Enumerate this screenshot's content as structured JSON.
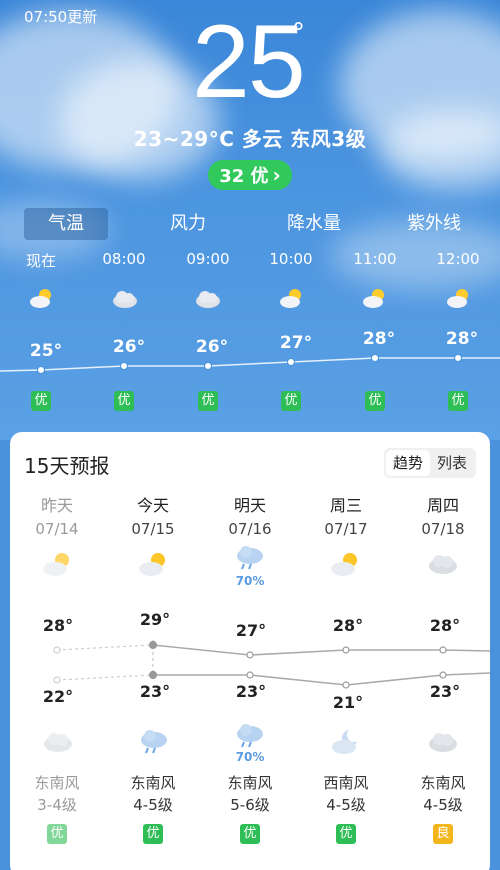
{
  "header": {
    "update_time": "07:50更新",
    "temperature": "25",
    "degree_symbol": "°",
    "summary": "23~29°C 多云 东风3级",
    "aqi_label": "32 优",
    "aqi_chevron": "›"
  },
  "tabs": [
    {
      "label": "气温",
      "active": true
    },
    {
      "label": "风力",
      "active": false
    },
    {
      "label": "降水量",
      "active": false
    },
    {
      "label": "紫外线",
      "active": false
    }
  ],
  "hourly": [
    {
      "time": "现在",
      "icon": "partly-cloudy-icon",
      "temp": "25°",
      "temp_value": 25,
      "aqi": "优"
    },
    {
      "time": "08:00",
      "icon": "cloudy-icon",
      "temp": "26°",
      "temp_value": 26,
      "aqi": "优"
    },
    {
      "time": "09:00",
      "icon": "cloudy-icon",
      "temp": "26°",
      "temp_value": 26,
      "aqi": "优"
    },
    {
      "time": "10:00",
      "icon": "partly-cloudy-icon",
      "temp": "27°",
      "temp_value": 27,
      "aqi": "优"
    },
    {
      "time": "11:00",
      "icon": "partly-cloudy-icon",
      "temp": "28°",
      "temp_value": 28,
      "aqi": "优"
    },
    {
      "time": "12:00",
      "icon": "partly-cloudy-icon",
      "temp": "28°",
      "temp_value": 28,
      "aqi": "优"
    }
  ],
  "forecast": {
    "title": "15天预报",
    "toggle": [
      "趋势",
      "列表"
    ],
    "days": [
      {
        "name": "昨天",
        "date": "07/14",
        "day_icon": "partly-cloudy-icon",
        "precip": "",
        "high": "28°",
        "high_value": 28,
        "low": "22°",
        "low_value": 22,
        "night_icon": "cloudy-icon",
        "night_precip": "",
        "wind_dir": "东南风",
        "wind_level": "3-4级",
        "aqi": "优",
        "past": true
      },
      {
        "name": "今天",
        "date": "07/15",
        "day_icon": "partly-cloudy-icon",
        "precip": "",
        "high": "29°",
        "high_value": 29,
        "low": "23°",
        "low_value": 23,
        "night_icon": "rain-cloud-icon",
        "night_precip": "",
        "wind_dir": "东南风",
        "wind_level": "4-5级",
        "aqi": "优",
        "past": false
      },
      {
        "name": "明天",
        "date": "07/16",
        "day_icon": "rain-cloud-icon",
        "precip": "70%",
        "high": "27°",
        "high_value": 27,
        "low": "23°",
        "low_value": 23,
        "night_icon": "rain-cloud-icon",
        "night_precip": "70%",
        "wind_dir": "东南风",
        "wind_level": "5-6级",
        "aqi": "优",
        "past": false
      },
      {
        "name": "周三",
        "date": "07/17",
        "day_icon": "partly-cloudy-icon",
        "precip": "",
        "high": "28°",
        "high_value": 28,
        "low": "21°",
        "low_value": 21,
        "night_icon": "moon-cloud-icon",
        "night_precip": "",
        "wind_dir": "西南风",
        "wind_level": "4-5级",
        "aqi": "优",
        "past": false
      },
      {
        "name": "周四",
        "date": "07/18",
        "day_icon": "cloudy-icon",
        "precip": "",
        "high": "28°",
        "high_value": 28,
        "low": "23°",
        "low_value": 23,
        "night_icon": "cloudy-icon",
        "night_precip": "",
        "wind_dir": "东南风",
        "wind_level": "4-5级",
        "aqi": "良",
        "past": false
      }
    ]
  },
  "colors": {
    "aqi_excellent": "#2fbe55",
    "aqi_good": "#f3b51c",
    "sky": "#4a93dc"
  }
}
